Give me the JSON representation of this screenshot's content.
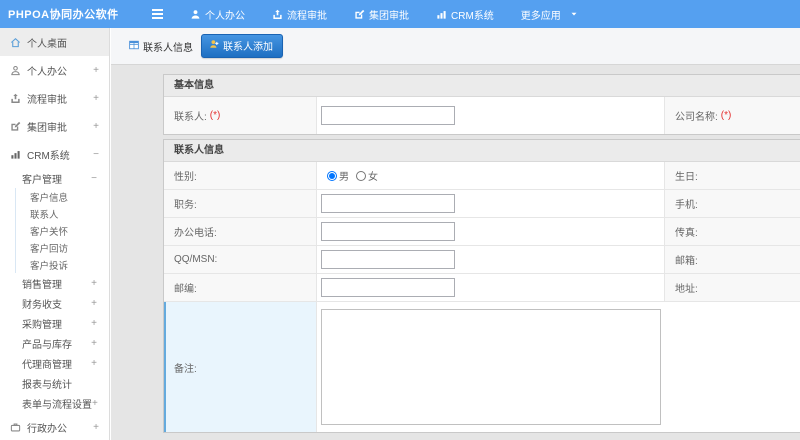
{
  "header": {
    "logo": "PHPOA协同办公软件",
    "nav": [
      {
        "label": "个人办公"
      },
      {
        "label": "流程审批"
      },
      {
        "label": "集团审批"
      },
      {
        "label": "CRM系统"
      },
      {
        "label": "更多应用"
      }
    ]
  },
  "sidebar": {
    "items": [
      {
        "label": "个人桌面",
        "expand": ""
      },
      {
        "label": "个人办公",
        "expand": "+"
      },
      {
        "label": "流程审批",
        "expand": "+"
      },
      {
        "label": "集团审批",
        "expand": "+"
      },
      {
        "label": "CRM系统",
        "expand": "−"
      },
      {
        "label": "客户管理",
        "expand": "−"
      },
      {
        "label": "客户信息"
      },
      {
        "label": "联系人"
      },
      {
        "label": "客户关怀"
      },
      {
        "label": "客户回访"
      },
      {
        "label": "客户投诉"
      },
      {
        "label": "销售管理",
        "expand": "+"
      },
      {
        "label": "财务收支",
        "expand": "+"
      },
      {
        "label": "采购管理",
        "expand": "+"
      },
      {
        "label": "产品与库存",
        "expand": "+"
      },
      {
        "label": "代理商管理",
        "expand": "+"
      },
      {
        "label": "报表与统计",
        "expand": ""
      },
      {
        "label": "表单与流程设置",
        "expand": "+"
      },
      {
        "label": "行政办公",
        "expand": "+"
      }
    ]
  },
  "tabs": [
    {
      "label": "联系人信息"
    },
    {
      "label": "联系人添加"
    }
  ],
  "form": {
    "sections": [
      {
        "title": "基本信息",
        "rows": [
          {
            "label": "联系人:",
            "req": "(*)",
            "label2": "公司名称:",
            "req2": "(*)"
          }
        ]
      },
      {
        "title": "联系人信息",
        "rows": [
          {
            "label": "性别:",
            "options": [
              "男",
              "女"
            ],
            "selected": "男",
            "label2": "生日:"
          },
          {
            "label": "职务:",
            "label2": "手机:"
          },
          {
            "label": "办公电话:",
            "label2": "传真:"
          },
          {
            "label": "QQ/MSN:",
            "label2": "邮箱:"
          },
          {
            "label": "邮编:",
            "label2": "地址:"
          },
          {
            "label": "备注:"
          }
        ]
      }
    ]
  },
  "colors": {
    "header_bg": "#55a0f0",
    "active_tab": "#2277cd",
    "highlight_cell_bg": "#e9f5fd",
    "highlight_cell_border": "#64aadd",
    "required": "#e53030"
  }
}
